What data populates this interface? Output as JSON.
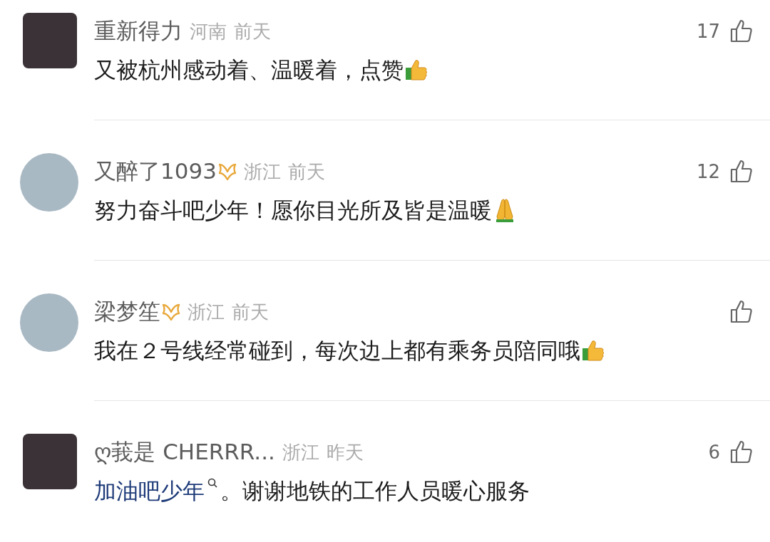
{
  "comments": [
    {
      "kind": "square-avatar",
      "name": "重新得力",
      "badge": false,
      "location": "河南",
      "time": "前天",
      "likes": "17",
      "content": [
        {
          "kind": "text",
          "text": "又被杭州感动着、温暖着，点赞"
        },
        {
          "kind": "thumb"
        }
      ]
    },
    {
      "kind": "round-avatar",
      "name": "又醉了1093",
      "badge": true,
      "location": "浙江",
      "time": "前天",
      "likes": "12",
      "content": [
        {
          "kind": "text",
          "text": "努力奋斗吧少年！愿你目光所及皆是温暖"
        },
        {
          "kind": "pray"
        }
      ]
    },
    {
      "kind": "round-avatar",
      "name": "梁梦笙",
      "badge": true,
      "location": "浙江",
      "time": "前天",
      "content": [
        {
          "kind": "text",
          "text": "我在２号线经常碰到，每次边上都有乘务员陪同哦"
        },
        {
          "kind": "thumb"
        }
      ]
    },
    {
      "kind": "square-avatar",
      "name": "ღ莪是 CHERRR...",
      "badge": false,
      "location": "浙江",
      "time": "昨天",
      "likes": "6",
      "content": [
        {
          "kind": "link",
          "text": "加油吧少年"
        },
        {
          "kind": "text",
          "text": "。谢谢地铁的工作人员暖心服务"
        }
      ]
    }
  ]
}
